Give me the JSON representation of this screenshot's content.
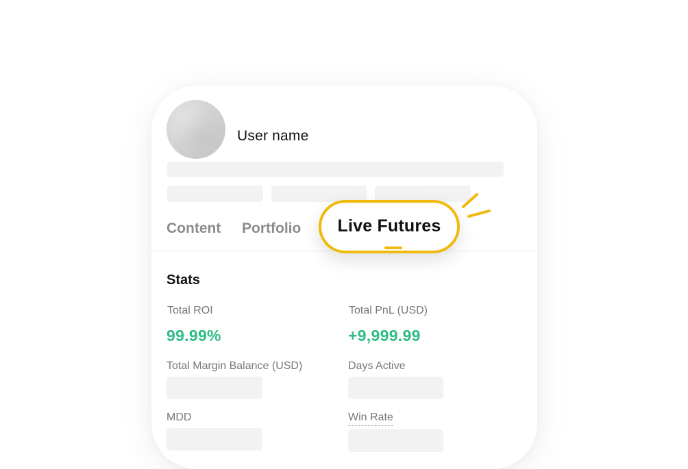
{
  "profile": {
    "user_name": "User name"
  },
  "tabs": [
    {
      "label": "Content"
    },
    {
      "label": "Portfolio"
    },
    {
      "label": "Live Futures"
    }
  ],
  "stats": {
    "title": "Stats",
    "total_roi": {
      "label": "Total ROI",
      "value": "99.99%"
    },
    "total_pnl": {
      "label": "Total PnL (USD)",
      "value": "+9,999.99"
    },
    "total_margin_balance": {
      "label": "Total Margin Balance (USD)"
    },
    "days_active": {
      "label": "Days Active"
    },
    "mdd": {
      "label": "MDD"
    },
    "win_rate": {
      "label": "Win Rate"
    }
  },
  "colors": {
    "accent": "#f0b90b",
    "positive": "#2ebd85",
    "placeholder": "#f2f2f2"
  }
}
